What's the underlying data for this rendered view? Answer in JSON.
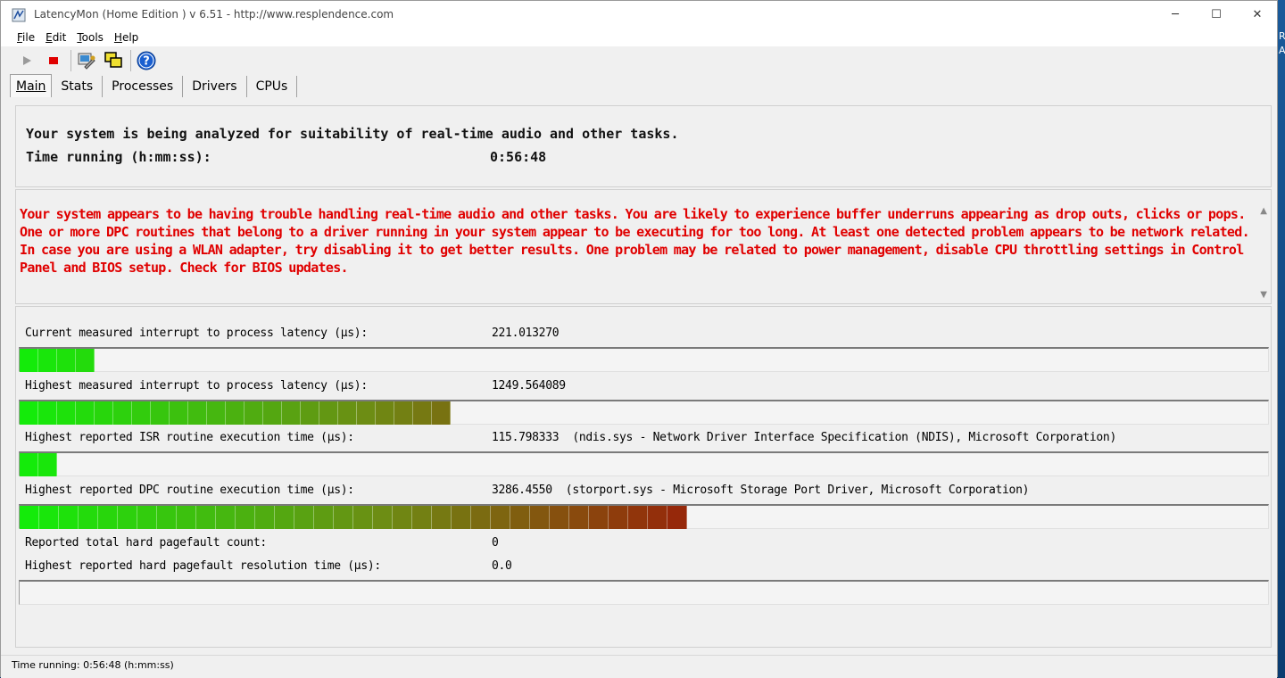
{
  "window": {
    "title": "LatencyMon  (Home Edition )  v 6.51 - http://www.resplendence.com",
    "minimize": "─",
    "maximize": "☐",
    "close": "✕"
  },
  "menu": [
    {
      "label": "File",
      "key": "F",
      "rest": "ile"
    },
    {
      "label": "Edit",
      "key": "E",
      "rest": "dit"
    },
    {
      "label": "Tools",
      "key": "T",
      "rest": "ools"
    },
    {
      "label": "Help",
      "key": "H",
      "rest": "elp"
    }
  ],
  "toolbar": {
    "start_icon": "play-icon",
    "stop_icon": "stop-icon",
    "tools_icon": "wrench-icon",
    "windows_icon": "windows-icon",
    "help_icon": "help-icon",
    "stop_color": "#e00000",
    "help_color": "#1a5fd0"
  },
  "tabs": [
    "Main",
    "Stats",
    "Processes",
    "Drivers",
    "CPUs"
  ],
  "header": {
    "line1": "Your system is being analyzed for suitability of real-time audio and other tasks.",
    "line2_label": "Time running (h:mm:ss):",
    "line2_value": "0:56:48"
  },
  "conclusion": {
    "text": "Your system appears to be having trouble handling real-time audio and other tasks. You are likely to experience buffer underruns appearing as drop outs, clicks or pops. One or more DPC routines that belong to a driver running in your system appear to be executing for too long. At least one detected problem appears to be network related. In case you are using a WLAN adapter, try disabling it to get better results. One problem may be related to power management, disable CPU throttling settings in Control Panel and BIOS setup. Check for BIOS updates.",
    "color": "#e00000"
  },
  "metrics": [
    {
      "label": "Current measured interrupt to process latency (µs):",
      "value": "221.013270",
      "level_segments": 4
    },
    {
      "label": "Highest measured interrupt to process latency (µs):",
      "value": "1249.564089",
      "level_segments": 23
    },
    {
      "label": "Highest reported ISR routine execution time (µs):",
      "value": "115.798333  (ndis.sys - Network Driver Interface Specification (NDIS), Microsoft Corporation)",
      "level_segments": 2
    },
    {
      "label": "Highest reported DPC routine execution time (µs):",
      "value": "3286.4550  (storport.sys - Microsoft Storage Port Driver, Microsoft Corporation)",
      "level_segments": 34
    }
  ],
  "pagefaults": [
    {
      "label": "Reported total hard pagefault count:",
      "value": "0"
    },
    {
      "label": "Highest reported hard pagefault resolution time (µs):",
      "value": "0.0"
    }
  ],
  "status": {
    "text": "Time running: 0:56:48  (h:mm:ss)"
  },
  "desktop": {
    "letters": [
      "R",
      "A"
    ]
  }
}
